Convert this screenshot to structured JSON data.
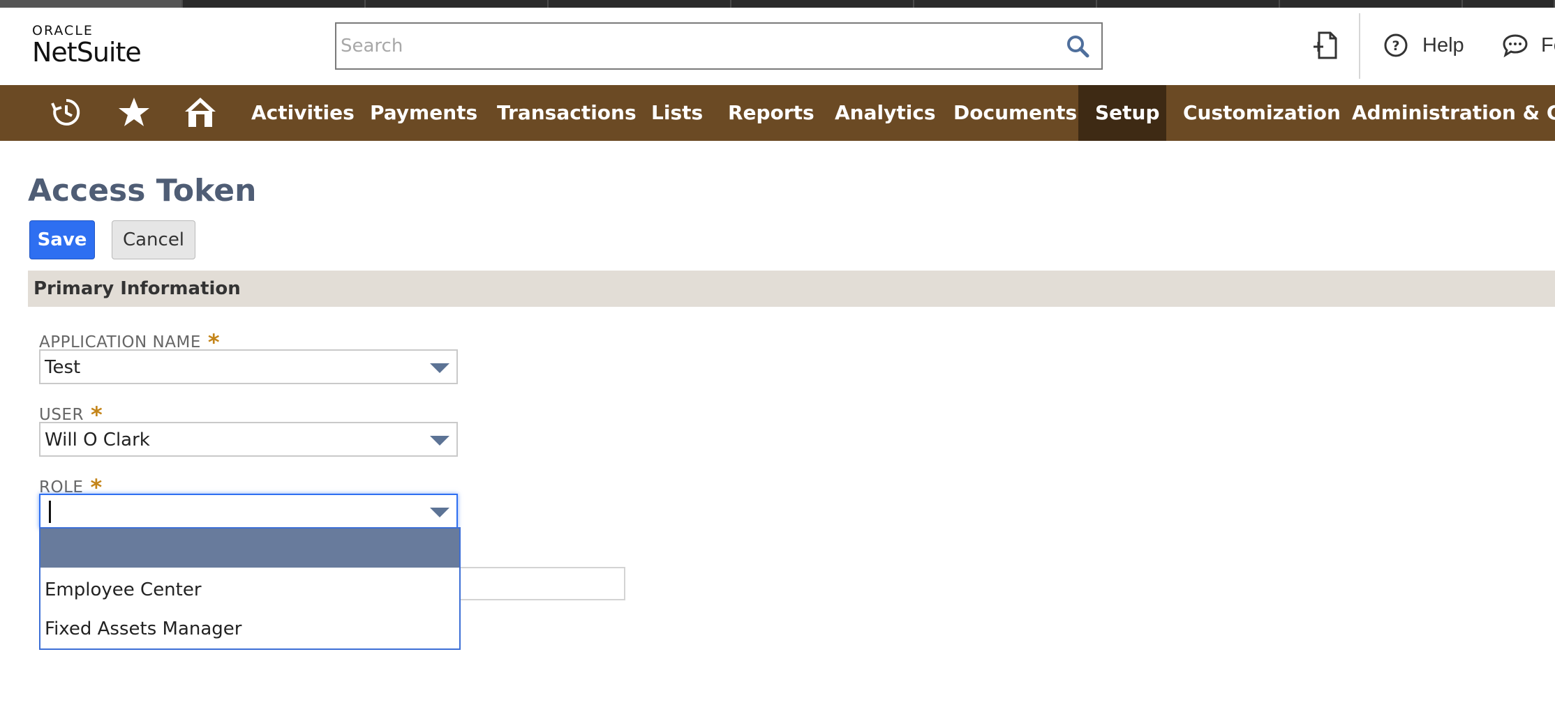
{
  "header": {
    "logo_oracle": "ORACLE",
    "logo_netsuite": "NetSuite",
    "search_placeholder": "Search",
    "help_label": "Help",
    "feedback_label": "Fe"
  },
  "nav": {
    "items": [
      {
        "label": "Activities"
      },
      {
        "label": "Payments"
      },
      {
        "label": "Transactions"
      },
      {
        "label": "Lists"
      },
      {
        "label": "Reports"
      },
      {
        "label": "Analytics"
      },
      {
        "label": "Documents"
      },
      {
        "label": "Setup",
        "active": true
      },
      {
        "label": "Customization"
      },
      {
        "label": "Administration & Con"
      }
    ],
    "icons": [
      "recent-records-icon",
      "star-icon",
      "home-icon"
    ]
  },
  "page": {
    "title": "Access Token",
    "save_label": "Save",
    "cancel_label": "Cancel",
    "section_title": "Primary Information"
  },
  "form": {
    "application_name": {
      "label": "APPLICATION NAME",
      "required": "*",
      "value": "Test"
    },
    "user": {
      "label": "USER",
      "required": "*",
      "value": "Will O Clark"
    },
    "role": {
      "label": "ROLE",
      "required": "*",
      "value": ""
    }
  },
  "role_dropdown": {
    "options": [
      "",
      "Employee Center",
      "Fixed Assets Manager"
    ],
    "highlighted_index": 0
  },
  "colors": {
    "nav_bg": "#6b4a24",
    "nav_active": "#3e2a14",
    "primary_button": "#2e6ff1",
    "title": "#4f5d75",
    "section_bg": "#e2ddd6",
    "required_star": "#c4851a",
    "dropdown_highlight": "#687b9c"
  }
}
